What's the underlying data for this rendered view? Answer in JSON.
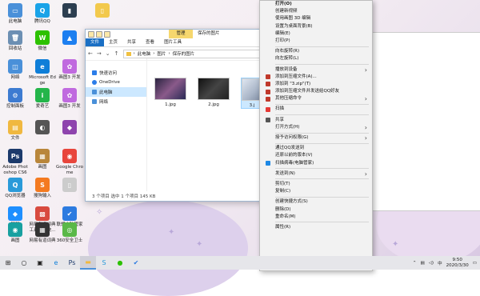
{
  "desktop": {
    "icons": [
      {
        "label": "此电脑",
        "glyph": "▭",
        "color": "#4a90d9"
      },
      {
        "label": "腾讯QQ",
        "glyph": "Q",
        "color": "#1aa3e8"
      },
      {
        "label": "",
        "glyph": "▮",
        "color": "#2c3e50"
      },
      {
        "label": "",
        "glyph": "▯",
        "color": "#f2c94c"
      },
      {
        "label": "回收站",
        "glyph": "🗑",
        "color": "#6c8fb3"
      },
      {
        "label": "微信",
        "glyph": "W",
        "color": "#2dc100"
      },
      {
        "label": "",
        "glyph": "▲",
        "color": "#1d7ff0"
      },
      {
        "label": "网络",
        "glyph": "◫",
        "color": "#4a90d9"
      },
      {
        "label": "Microsoft Edge",
        "glyph": "e",
        "color": "#0f7ed8"
      },
      {
        "label": "画图3 开发",
        "glyph": "✿",
        "color": "#c06adf"
      },
      {
        "label": "控制面板",
        "glyph": "⚙",
        "color": "#3d7bd1"
      },
      {
        "label": "爱奇艺",
        "glyph": "i",
        "color": "#24b54a"
      },
      {
        "label": "画图3 开发",
        "glyph": "✿",
        "color": "#c06adf"
      },
      {
        "label": "文件",
        "glyph": "▤",
        "color": "#f0b840"
      },
      {
        "label": "",
        "glyph": "◐",
        "color": "#555"
      },
      {
        "label": "",
        "glyph": "◆",
        "color": "#8e44ad"
      },
      {
        "label": "Adobe Photoshop CS6",
        "glyph": "Ps",
        "color": "#1c3a6b"
      },
      {
        "label": "画图",
        "glyph": "▦",
        "color": "#b9863b"
      },
      {
        "label": "Google Chrome",
        "glyph": "◉",
        "color": "#e8453c"
      },
      {
        "label": "QQ浏览器",
        "glyph": "Q",
        "color": "#2a9ad9"
      },
      {
        "label": "搜狗输入",
        "glyph": "S",
        "color": "#f47a20"
      },
      {
        "label": "",
        "glyph": "▯",
        "color": "#ccc"
      },
      {
        "label": "钉钉",
        "glyph": "◆",
        "color": "#1e8fff"
      },
      {
        "label": "网易有道词典 工具箱 - 快...",
        "glyph": "▩",
        "color": "#d84a3f"
      },
      {
        "label": "联想电脑管家",
        "glyph": "✔",
        "color": "#2d7be0"
      },
      {
        "label": "画图",
        "glyph": "◉",
        "color": "#18a0a0"
      },
      {
        "label": "网易有道词典",
        "glyph": "▦",
        "color": "#333"
      },
      {
        "label": "360安全卫士",
        "glyph": "◎",
        "color": "#5ab848"
      }
    ]
  },
  "explorer": {
    "manage_tab": "管理",
    "title": "保存的图片",
    "tabs": [
      "文件",
      "主页",
      "共享",
      "查看",
      "图片工具"
    ],
    "breadcrumb": [
      "此电脑",
      "图片",
      "保存的图片"
    ],
    "nav": [
      {
        "label": "快速访问",
        "color": "#2b7de9"
      },
      {
        "label": "OneDrive",
        "color": "#2b7de9"
      },
      {
        "label": "此电脑",
        "color": "#4a90d9"
      },
      {
        "label": "网络",
        "color": "#4a90d9"
      }
    ],
    "files": [
      {
        "name": "1.jpg"
      },
      {
        "name": "2.jpg"
      },
      {
        "name": "3.j"
      }
    ],
    "status": "3 个项目    选中 1 个项目  145 KB"
  },
  "context_menu": {
    "items": [
      {
        "label": "打开(O)",
        "bold": true
      },
      {
        "label": "创建新视频"
      },
      {
        "label": "使用画图 3D 编辑"
      },
      {
        "label": "设置为桌面背景(B)"
      },
      {
        "label": "编辑(E)"
      },
      {
        "label": "打印(P)"
      },
      {
        "sep": true
      },
      {
        "label": "向右旋转(R)"
      },
      {
        "label": "向左旋转(L)"
      },
      {
        "sep": true
      },
      {
        "label": "播放到设备",
        "sub": true
      },
      {
        "label": "添加到压缩文件(A)...",
        "icon_color": "#c0392b"
      },
      {
        "label": "添加到 \"3.zip\"(T)",
        "icon_color": "#c0392b"
      },
      {
        "label": "添加到压缩文件并发送给QQ好友",
        "icon_color": "#c0392b"
      },
      {
        "label": "其他压缩命令",
        "sub": true,
        "icon_color": "#c0392b"
      },
      {
        "sep": true
      },
      {
        "label": "扫描",
        "icon_color": "#e53935"
      },
      {
        "sep": true
      },
      {
        "label": "共享",
        "icon_color": "#555"
      },
      {
        "label": "打开方式(H)",
        "sub": true
      },
      {
        "sep": true
      },
      {
        "label": "授予访问权限(G)",
        "sub": true
      },
      {
        "sep": true
      },
      {
        "label": "通过QQ发送到"
      },
      {
        "label": "还原以前的版本(V)"
      },
      {
        "label": "扫描病毒(电脑管家)",
        "icon_color": "#1e88e5"
      },
      {
        "sep": true
      },
      {
        "label": "发送到(N)",
        "sub": true
      },
      {
        "sep": true
      },
      {
        "label": "剪切(T)"
      },
      {
        "label": "复制(C)"
      },
      {
        "sep": true
      },
      {
        "label": "创建快捷方式(S)"
      },
      {
        "label": "删除(D)"
      },
      {
        "label": "重命名(M)"
      },
      {
        "sep": true
      },
      {
        "label": "属性(R)"
      }
    ]
  },
  "taskbar": {
    "items": [
      {
        "name": "start",
        "glyph": "⊞",
        "color": "#222",
        "active": false
      },
      {
        "name": "search",
        "glyph": "○",
        "color": "#222",
        "active": false
      },
      {
        "name": "task-view",
        "glyph": "▣",
        "color": "#222",
        "active": false
      },
      {
        "name": "edge",
        "glyph": "e",
        "color": "#0f7ed8",
        "active": false
      },
      {
        "name": "photoshop",
        "glyph": "Ps",
        "color": "#1c3a6b",
        "active": false
      },
      {
        "name": "explorer",
        "glyph": "▬",
        "color": "#f0b840",
        "active": true
      },
      {
        "name": "sogou",
        "glyph": "S",
        "color": "#2a9ad9",
        "active": false
      },
      {
        "name": "wechat",
        "glyph": "●",
        "color": "#2dc100",
        "active": false
      },
      {
        "name": "security",
        "glyph": "✔",
        "color": "#2d7be0",
        "active": false
      }
    ],
    "time": "9:50",
    "date": "2020/3/30",
    "ime": "中"
  }
}
